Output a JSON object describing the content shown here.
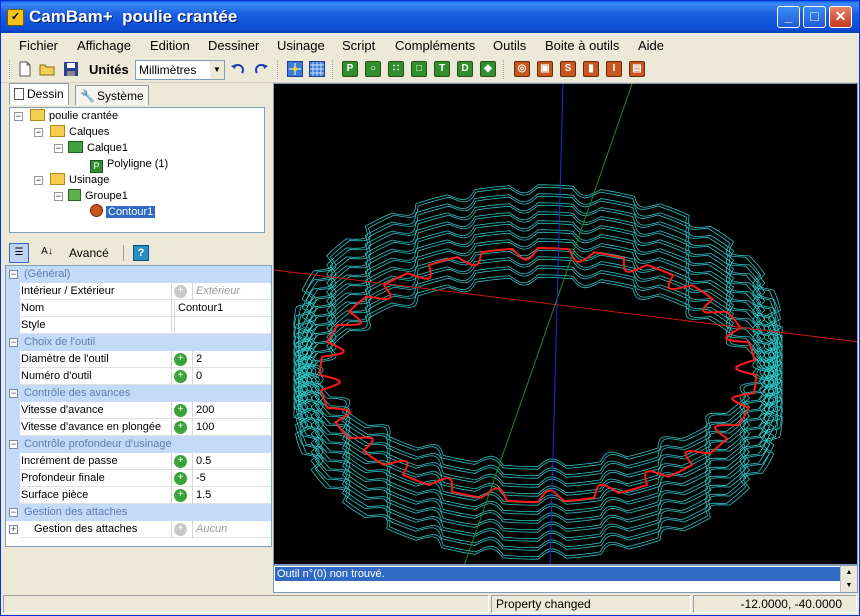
{
  "window": {
    "title": "CamBam+  poulie crantée"
  },
  "menu": [
    "Fichier",
    "Affichage",
    "Edition",
    "Dessiner",
    "Usinage",
    "Script",
    "Compléments",
    "Outils",
    "Boite à outils",
    "Aide"
  ],
  "toolbar": {
    "units_label": "Unités",
    "units_value": "Millimètres"
  },
  "left_tabs": [
    "Dessin",
    "Système"
  ],
  "tree": {
    "root": "poulie crantée",
    "calques": "Calques",
    "calque1": "Calque1",
    "polyligne": "Polyligne (1)",
    "usinage": "Usinage",
    "groupe1": "Groupe1",
    "contour1": "Contour1"
  },
  "prop_toolbar": {
    "avance_label": "Avancé",
    "help_label": "?"
  },
  "properties": {
    "cat_general": "(Général)",
    "interieur_exterieur": {
      "name": "Intérieur / Extérieur",
      "value": "Extérieur"
    },
    "nom": {
      "name": "Nom",
      "value": "Contour1"
    },
    "style": {
      "name": "Style",
      "value": ""
    },
    "cat_outil": "Choix de l'outil",
    "diametre": {
      "name": "Diamètre de l'outil",
      "value": "2"
    },
    "numero": {
      "name": "Numéro d'outil",
      "value": "0"
    },
    "cat_avances": "Contrôle des avances",
    "vitesse": {
      "name": "Vitesse d'avance",
      "value": "200"
    },
    "vitesse_plongee": {
      "name": "Vitesse d'avance en plongée",
      "value": "100"
    },
    "cat_profondeur": "Contrôle profondeur d'usinage",
    "increment": {
      "name": "Incrément de passe",
      "value": "0.5"
    },
    "profondeur": {
      "name": "Profondeur finale",
      "value": "-5"
    },
    "surface": {
      "name": "Surface pièce",
      "value": "1.5"
    },
    "cat_attaches": "Gestion des attaches",
    "gestion": {
      "name": "Gestion des attaches",
      "value": "Aucun"
    }
  },
  "messages": {
    "line1": "Outil n°(0) non trouvé."
  },
  "status": {
    "message": "Property changed",
    "coords": "-12.0000, -40.0000"
  },
  "colors": {
    "titlebar": "#0b4cd4",
    "toolpath": "#2bc4c4",
    "contour": "#ff1a1a",
    "axis_x": "#c81414",
    "axis_y": "#1e8c1e",
    "axis_z": "#1c2fd0",
    "selection": "#316ac5",
    "category": "#c3daf9"
  }
}
